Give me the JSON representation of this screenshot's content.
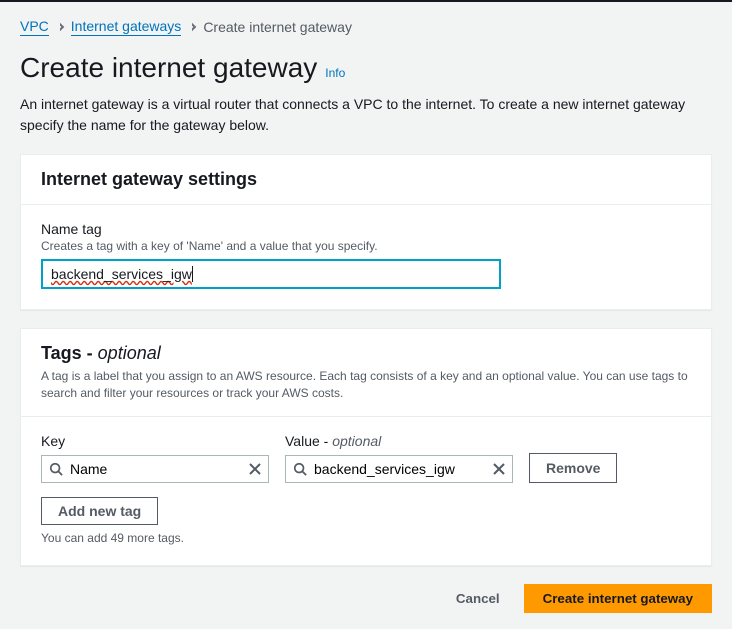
{
  "breadcrumb": {
    "vpc": "VPC",
    "igw": "Internet gateways",
    "current": "Create internet gateway"
  },
  "header": {
    "title": "Create internet gateway",
    "info": "Info",
    "description": "An internet gateway is a virtual router that connects a VPC to the internet. To create a new internet gateway specify the name for the gateway below."
  },
  "settings": {
    "panel_title": "Internet gateway settings",
    "name_label": "Name tag",
    "name_hint": "Creates a tag with a key of 'Name' and a value that you specify.",
    "name_value": "backend_services_igw"
  },
  "tags": {
    "panel_title": "Tags - ",
    "panel_title_optional": "optional",
    "panel_desc": "A tag is a label that you assign to an AWS resource. Each tag consists of a key and an optional value. You can use tags to search and filter your resources or track your AWS costs.",
    "key_label": "Key",
    "value_label": "Value - ",
    "value_optional": "optional",
    "key_value": "Name",
    "value_value": "backend_services_igw",
    "remove_label": "Remove",
    "add_label": "Add new tag",
    "limit_text": "You can add 49 more tags."
  },
  "actions": {
    "cancel": "Cancel",
    "create": "Create internet gateway"
  }
}
